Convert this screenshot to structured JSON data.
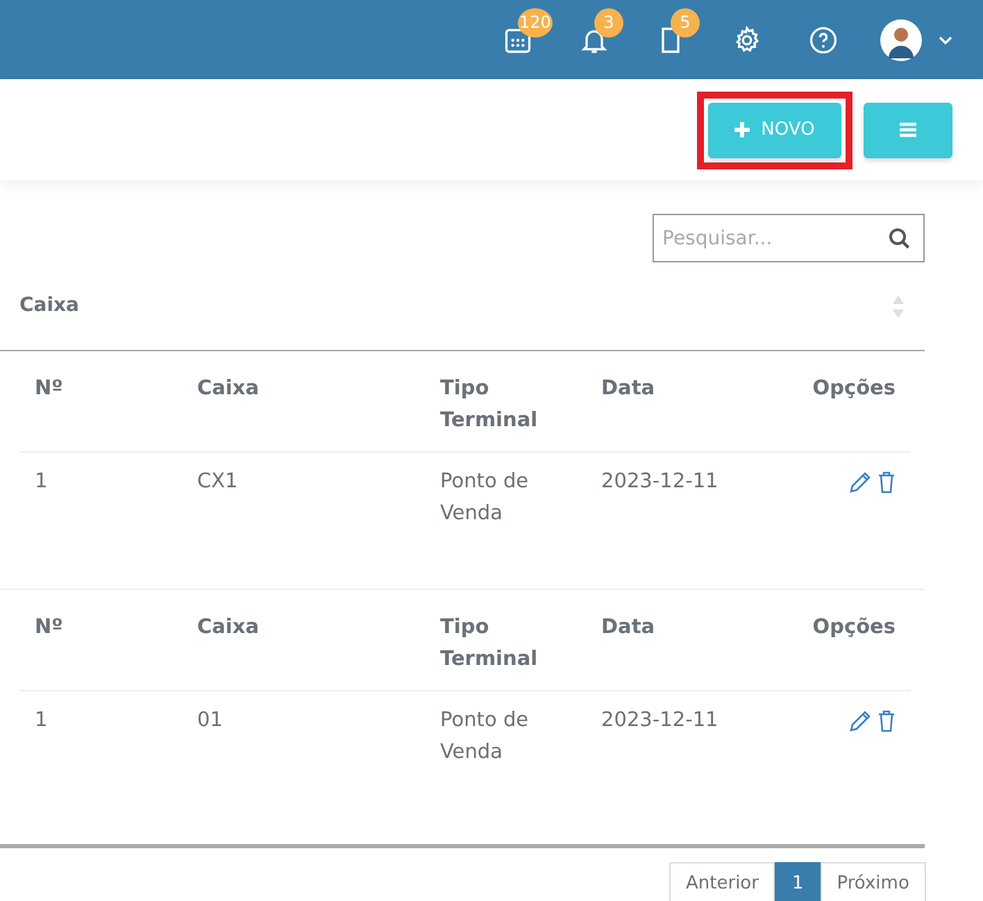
{
  "header": {
    "icons": [
      {
        "kind": "calendar",
        "badge": "120"
      },
      {
        "kind": "bell",
        "badge": "3"
      },
      {
        "kind": "document",
        "badge": "5"
      },
      {
        "kind": "settings"
      },
      {
        "kind": "help"
      }
    ]
  },
  "toolbar": {
    "buttons": [
      {
        "kind": "new",
        "label": "NOVO",
        "highlighted": true
      },
      {
        "kind": "menu",
        "highlighted": false
      }
    ]
  },
  "search": {
    "placeholder": "Pesquisar..."
  },
  "section": {
    "title": "Caixa"
  },
  "groups": [
    {
      "columns": [
        "Nº",
        "Caixa",
        "Tipo Terminal",
        "Data",
        "Opções"
      ],
      "rows": [
        {
          "cells": [
            "1",
            "CX1",
            "Ponto de Venda",
            "2023-12-11"
          ]
        }
      ]
    },
    {
      "columns": [
        "Nº",
        "Caixa",
        "Tipo Terminal",
        "Data",
        "Opções"
      ],
      "rows": [
        {
          "cells": [
            "1",
            "01",
            "Ponto de Venda",
            "2023-12-11"
          ]
        }
      ]
    }
  ],
  "pagination": [
    {
      "label": "Anterior",
      "selected": false
    },
    {
      "label": "1",
      "selected": true
    },
    {
      "label": "Próximo",
      "selected": false
    }
  ]
}
